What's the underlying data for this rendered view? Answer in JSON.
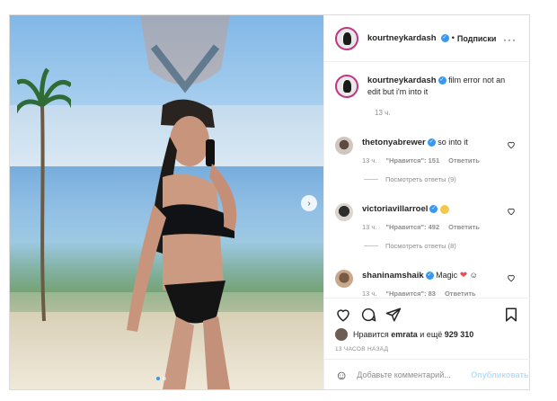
{
  "post": {
    "author": "kourtneykardash",
    "follow_separator": "•",
    "follow_label": "Подписки",
    "more_icon": "more-horizontal-icon",
    "carousel": {
      "slide_count": 2,
      "active_slide": 1
    },
    "caption": {
      "username": "kourtneykardash",
      "text": "film error not an edit but i'm into it",
      "time": "13 ч."
    },
    "comments": [
      {
        "username": "thetonyabrewer",
        "text": "so into it",
        "time": "13 ч.",
        "likes": "\"Нравится\": 151",
        "reply_label": "Ответить",
        "view_replies": "Посмотреть ответы (9)"
      },
      {
        "username": "victoriavillarroel",
        "text": "",
        "emoji": "smiling-face",
        "time": "13 ч.",
        "likes": "\"Нравится\": 492",
        "reply_label": "Ответить",
        "view_replies": "Посмотреть ответы (8)"
      },
      {
        "username": "shaninamshaik",
        "text": "Magic",
        "emoji": "red-heart",
        "time": "13 ч.",
        "likes": "\"Нравится\": 83",
        "reply_label": "Ответить"
      }
    ],
    "likes_summary": {
      "prefix": "Нравится",
      "user": "emrata",
      "suffix": "и ещё",
      "count": "929 310"
    },
    "posted_time": "13 ЧАСОВ НАЗАД",
    "add_comment": {
      "placeholder": "Добавьте комментарий...",
      "publish_label": "Опубликовать"
    }
  },
  "colors": {
    "accent": "#3897f0",
    "text": "#262626",
    "muted": "#8e8e8e",
    "like": "#ed4956",
    "publish_disabled": "#b2dffc"
  }
}
